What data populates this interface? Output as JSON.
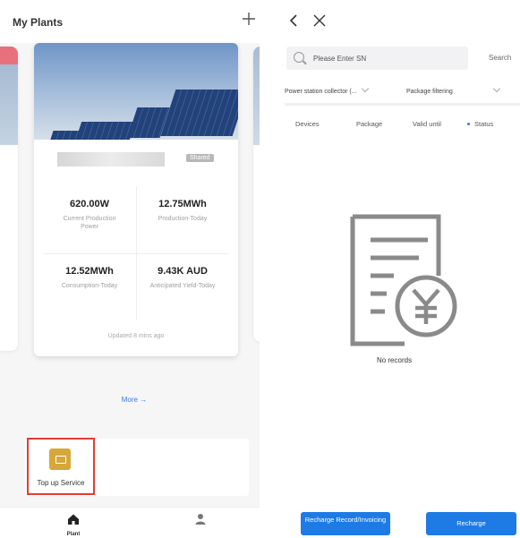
{
  "left": {
    "title": "My Plants",
    "add_icon": "plus-icon",
    "card": {
      "shared_badge": "Shared",
      "stats": [
        {
          "value": "620.00W",
          "label": "Current Production Power"
        },
        {
          "value": "12.75MWh",
          "label": "Production-Today"
        },
        {
          "value": "12.52MWh",
          "label": "Consumption-Today"
        },
        {
          "value": "9.43K AUD",
          "label": "Anticipated Yield-Today"
        }
      ],
      "updated": "Updated 8 mins ago"
    },
    "more": "More →",
    "service": {
      "label": "Top up Service",
      "icon": "top-up-icon",
      "highlight_color": "#e23b35"
    },
    "tabs": [
      {
        "label": "Plant",
        "icon": "home-icon"
      },
      {
        "label": "",
        "icon": "user-icon"
      }
    ]
  },
  "right": {
    "back_icon": "back-chevron-icon",
    "close_icon": "close-icon",
    "search": {
      "placeholder": "Please Enter SN",
      "button": "Search"
    },
    "filters": [
      "Power station collector (...",
      "Package filtering"
    ],
    "columns": [
      "Devices",
      "Package",
      "Valid until",
      "Status"
    ],
    "empty": {
      "icon": "document-yen-icon",
      "text": "No records"
    },
    "buttons": {
      "records": "Recharge Record/Invoicing",
      "recharge": "Recharge"
    },
    "accent_color": "#1e7be6"
  }
}
